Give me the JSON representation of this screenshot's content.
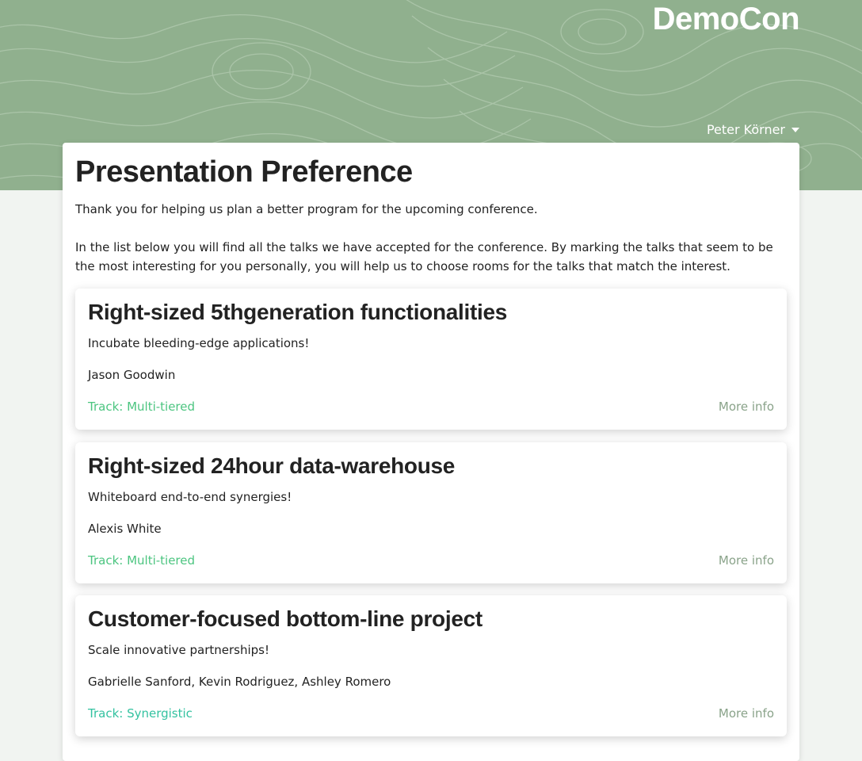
{
  "header": {
    "brand": "DemoCon",
    "user_name": "Peter Körner",
    "colors": {
      "hero_bg": "#90b08e",
      "track_link": "#4cc580",
      "more_info": "#8aa38a"
    }
  },
  "main": {
    "title": "Presentation Preference",
    "intro_1": "Thank you for helping us plan a better program for the upcoming conference.",
    "intro_2": "In the list below you will find all the talks we have accepted for the conference. By marking the talks that seem to be the most interesting for you personally, you will help us to choose rooms for the talks that match the interest.",
    "talks": [
      {
        "title": "Right-sized 5thgeneration functionalities",
        "abstract": "Incubate bleeding-edge applications!",
        "speakers": "Jason Goodwin",
        "track": "Track: Multi-tiered",
        "more": "More info"
      },
      {
        "title": "Right-sized 24hour data-warehouse",
        "abstract": "Whiteboard end-to-end synergies!",
        "speakers": "Alexis White",
        "track": "Track: Multi-tiered",
        "more": "More info"
      },
      {
        "title": "Customer-focused bottom-line project",
        "abstract": "Scale innovative partnerships!",
        "speakers": "Gabrielle Sanford, Kevin Rodriguez, Ashley Romero",
        "track": "Track: Synergistic",
        "more": "More info"
      }
    ]
  }
}
